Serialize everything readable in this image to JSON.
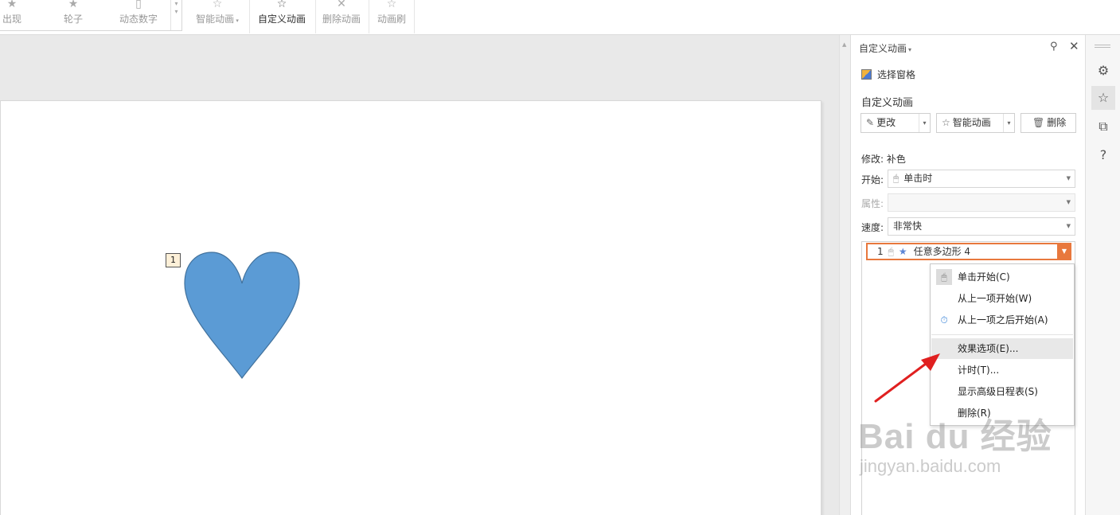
{
  "ribbon": {
    "gallery": [
      "出现",
      "轮子",
      "动态数字"
    ],
    "buttons": [
      "智能动画",
      "自定义动画",
      "删除动画",
      "动画刷"
    ]
  },
  "slide": {
    "animation_tag": "1",
    "shape_color": "#5b9bd5"
  },
  "pane": {
    "title": "自定义动画",
    "select_pane": "选择窗格",
    "section_title": "自定义动画",
    "change_button": "更改",
    "smart_button": "智能动画",
    "delete_button": "删除",
    "modify_label": "修改: 补色",
    "start_label": "开始:",
    "start_value": "单击时",
    "property_label": "属性:",
    "speed_label": "速度:",
    "speed_value": "非常快",
    "list_item": {
      "index": "1",
      "name": "任意多边形 4"
    }
  },
  "menu": {
    "items": [
      "单击开始(C)",
      "从上一项开始(W)",
      "从上一项之后开始(A)",
      "效果选项(E)...",
      "计时(T)...",
      "显示高级日程表(S)",
      "删除(R)"
    ]
  },
  "colors": {
    "accent_orange": "#e8783d",
    "arrow_red": "#e02020"
  },
  "watermark": {
    "brand": "Bai du 经验",
    "url": "jingyan.baidu.com"
  }
}
